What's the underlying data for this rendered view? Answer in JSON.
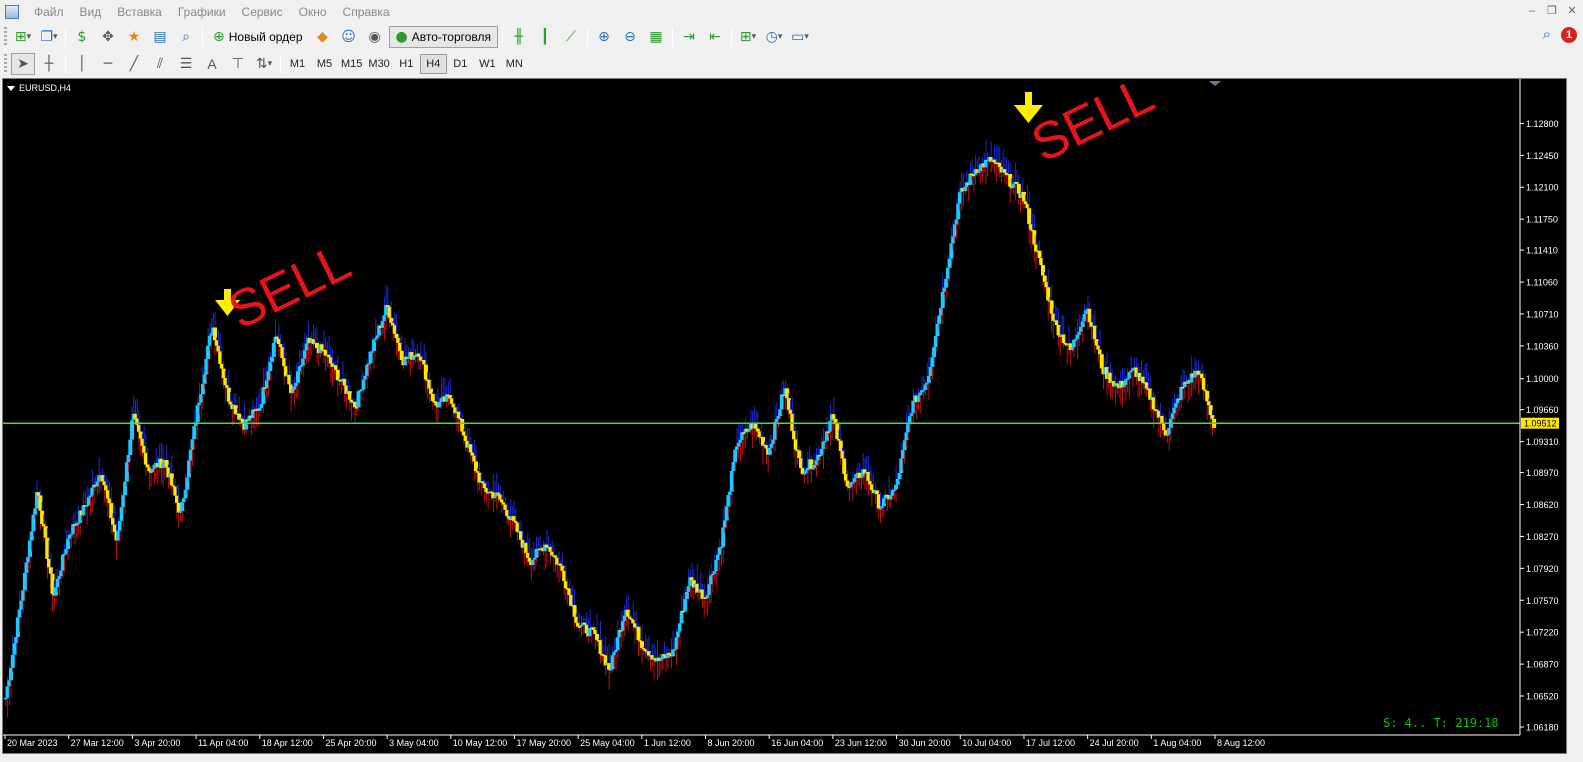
{
  "menu": {
    "items": [
      "Файл",
      "Вид",
      "Вставка",
      "Графики",
      "Сервис",
      "Окно",
      "Справка"
    ]
  },
  "window_controls": [
    "minimize-icon",
    "restore-icon",
    "close-icon"
  ],
  "toolbar": {
    "new_order_label": "Новый ордер",
    "autotrade_label": "Авто-торговля",
    "notification_count": "1"
  },
  "timeframes": [
    "M1",
    "M5",
    "M15",
    "M30",
    "H1",
    "H4",
    "D1",
    "W1",
    "MN"
  ],
  "active_timeframe": "H4",
  "chart": {
    "symbol_label": "EURUSD,H4",
    "status_text": "S: 4.. T: 219:18",
    "current_price_label": "1.09512",
    "annotations": [
      "SELL",
      "SELL"
    ],
    "colors": {
      "background": "#000000",
      "bull": "#1ec8ff",
      "bear": "#ffe600",
      "wick_up": "#1b2bd6",
      "wick_down": "#c01010",
      "price_line": "#33e833",
      "sell_text": "#e8141a",
      "arrow": "#ffee00",
      "axis_text": "#ffffff",
      "status_text": "#00c800"
    }
  },
  "chart_data": {
    "type": "candlestick",
    "symbol": "EURUSD",
    "timeframe": "H4",
    "ylim": [
      1.0618,
      1.1298
    ],
    "y_ticks": [
      "1.12800",
      "1.12450",
      "1.12100",
      "1.11750",
      "1.11410",
      "1.11060",
      "1.10710",
      "1.10360",
      "1.10000",
      "1.09660",
      "1.09310",
      "1.08970",
      "1.08620",
      "1.08270",
      "1.07920",
      "1.07570",
      "1.07220",
      "1.06870",
      "1.06520",
      "1.06180"
    ],
    "x_ticks": [
      "20 Mar 2023",
      "27 Mar 12:00",
      "3 Apr 20:00",
      "11 Apr 04:00",
      "18 Apr 12:00",
      "25 Apr 20:00",
      "3 May 04:00",
      "10 May 12:00",
      "17 May 20:00",
      "25 May 04:00",
      "1 Jun 12:00",
      "8 Jun 20:00",
      "16 Jun 04:00",
      "23 Jun 12:00",
      "30 Jun 20:00",
      "10 Jul 04:00",
      "17 Jul 12:00",
      "24 Jul 20:00",
      "1 Aug 04:00",
      "8 Aug 12:00"
    ],
    "current_price": 1.09512,
    "close_path": [
      [
        "20 Mar 2023",
        1.065
      ],
      [
        "22 Mar",
        1.076
      ],
      [
        "23 Mar",
        1.088
      ],
      [
        "24 Mar",
        1.076
      ],
      [
        "27 Mar 12:00",
        1.083
      ],
      [
        "29 Mar",
        1.086
      ],
      [
        "30 Mar",
        1.09
      ],
      [
        "31 Mar",
        1.082
      ],
      [
        "3 Apr 20:00",
        1.096
      ],
      [
        "5 Apr",
        1.09
      ],
      [
        "7 Apr",
        1.091
      ],
      [
        "10 Apr",
        1.085
      ],
      [
        "11 Apr 04:00",
        1.096
      ],
      [
        "13 Apr",
        1.106
      ],
      [
        "14 Apr",
        1.098
      ],
      [
        "17 Apr",
        1.095
      ],
      [
        "18 Apr 12:00",
        1.097
      ],
      [
        "20 Apr",
        1.105
      ],
      [
        "21 Apr",
        1.098
      ],
      [
        "24 Apr",
        1.104
      ],
      [
        "25 Apr 20:00",
        1.103
      ],
      [
        "27 Apr",
        1.1
      ],
      [
        "28 Apr",
        1.097
      ],
      [
        "1 May",
        1.103
      ],
      [
        "3 May 04:00",
        1.108
      ],
      [
        "4 May",
        1.102
      ],
      [
        "5 May",
        1.103
      ],
      [
        "8 May",
        1.097
      ],
      [
        "10 May 12:00",
        1.098
      ],
      [
        "11 May",
        1.093
      ],
      [
        "12 May",
        1.088
      ],
      [
        "15 May",
        1.087
      ],
      [
        "17 May 20:00",
        1.084
      ],
      [
        "19 May",
        1.08
      ],
      [
        "22 May",
        1.082
      ],
      [
        "23 May",
        1.079
      ],
      [
        "25 May 04:00",
        1.073
      ],
      [
        "29 May",
        1.072
      ],
      [
        "31 May",
        1.068
      ],
      [
        "1 Jun 12:00",
        1.075
      ],
      [
        "2 Jun",
        1.071
      ],
      [
        "5 Jun",
        1.069
      ],
      [
        "7 Jun",
        1.07
      ],
      [
        "8 Jun 20:00",
        1.078
      ],
      [
        "12 Jun",
        1.076
      ],
      [
        "14 Jun",
        1.082
      ],
      [
        "15 Jun",
        1.093
      ],
      [
        "16 Jun 04:00",
        1.095
      ],
      [
        "20 Jun",
        1.092
      ],
      [
        "22 Jun",
        1.099
      ],
      [
        "23 Jun 12:00",
        1.09
      ],
      [
        "26 Jun",
        1.091
      ],
      [
        "28 Jun",
        1.096
      ],
      [
        "29 Jun",
        1.088
      ],
      [
        "30 Jun 20:00",
        1.09
      ],
      [
        "5 Jul",
        1.086
      ],
      [
        "7 Jul",
        1.088
      ],
      [
        "10 Jul 04:00",
        1.097
      ],
      [
        "11 Jul",
        1.1
      ],
      [
        "12 Jul",
        1.11
      ],
      [
        "13 Jul",
        1.12
      ],
      [
        "14 Jul",
        1.123
      ],
      [
        "17 Jul 12:00",
        1.124
      ],
      [
        "18 Jul",
        1.122
      ],
      [
        "19 Jul",
        1.12
      ],
      [
        "20 Jul",
        1.113
      ],
      [
        "24 Jul 20:00",
        1.106
      ],
      [
        "26 Jul",
        1.103
      ],
      [
        "27 Jul",
        1.108
      ],
      [
        "28 Jul",
        1.101
      ],
      [
        "31 Jul",
        1.099
      ],
      [
        "1 Aug 04:00",
        1.101
      ],
      [
        "2 Aug",
        1.098
      ],
      [
        "3 Aug",
        1.094
      ],
      [
        "4 Aug",
        1.099
      ],
      [
        "7 Aug",
        1.101
      ],
      [
        "8 Aug 12:00",
        1.095
      ]
    ]
  }
}
